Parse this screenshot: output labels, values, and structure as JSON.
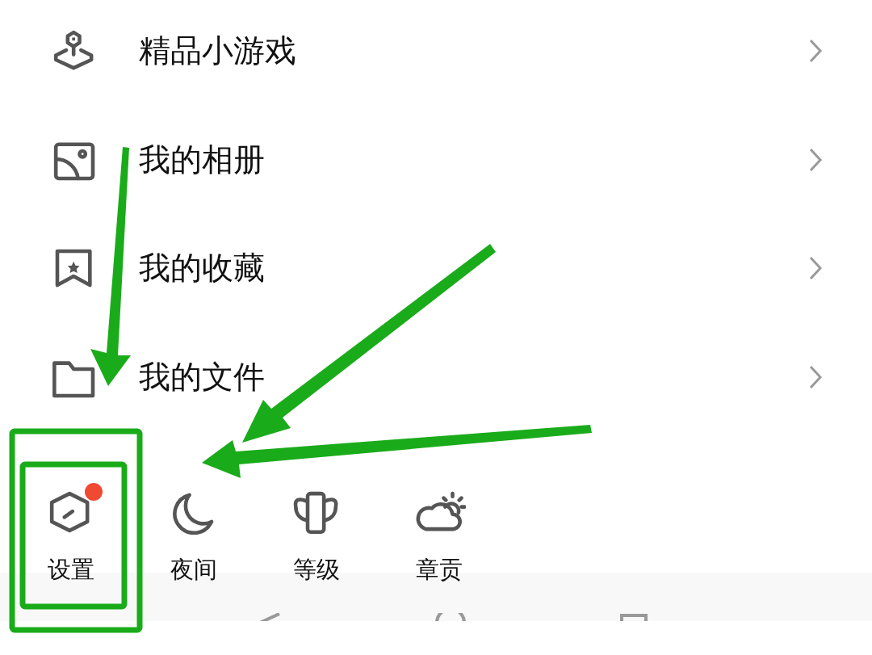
{
  "menu": [
    {
      "label": "精品小游戏"
    },
    {
      "label": "我的相册"
    },
    {
      "label": "我的收藏"
    },
    {
      "label": "我的文件"
    }
  ],
  "shortcuts": [
    {
      "label": "设置",
      "dot": true
    },
    {
      "label": "夜间",
      "dot": false
    },
    {
      "label": "等级",
      "dot": false
    },
    {
      "label": "章贡",
      "dot": false
    }
  ]
}
